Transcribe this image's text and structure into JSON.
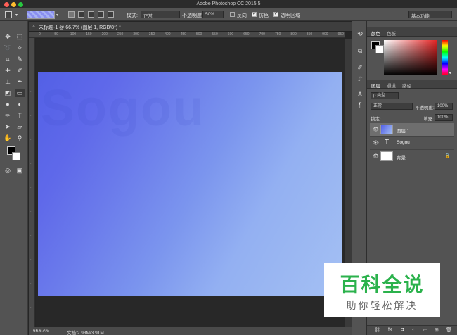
{
  "window": {
    "title": "Adobe Photoshop CC 2015.5"
  },
  "options_bar": {
    "mode_label": "模式:",
    "mode_value": "正常",
    "opacity_label": "不透明度:",
    "opacity_value": "50%",
    "reverse_label": "反向",
    "dither_label": "仿色",
    "transparency_label": "透明区域",
    "reverse_checked": false,
    "dither_checked": true,
    "transparency_checked": true,
    "workspace": "基本功能"
  },
  "document": {
    "tab_title": "未标题-1 @ 66.7% (图层 1, RGB/8*) *",
    "ruler_ticks": [
      "0",
      "50",
      "100",
      "150",
      "200",
      "250",
      "300",
      "350",
      "400",
      "450",
      "500",
      "550",
      "600",
      "650",
      "700",
      "750",
      "800",
      "850",
      "900",
      "950"
    ],
    "canvas_text": "Sogou"
  },
  "status": {
    "zoom": "66.67%",
    "doc_size": "文档:2.93M/3.91M"
  },
  "color_panel": {
    "tabs": [
      "颜色",
      "色板"
    ]
  },
  "layers_panel": {
    "tabs": [
      "图层",
      "通道",
      "路径"
    ],
    "filter_label": "ρ 类型",
    "blend_mode": "正常",
    "opacity_label": "不透明度:",
    "opacity_value": "100%",
    "lock_label": "锁定:",
    "fill_label": "填充:",
    "fill_value": "100%",
    "layers": [
      {
        "name": "图层 1",
        "type": "gradient",
        "selected": true
      },
      {
        "name": "Sogou",
        "type": "text",
        "selected": false
      },
      {
        "name": "背景",
        "type": "background",
        "selected": false
      }
    ]
  },
  "watermark": {
    "main": "百科全说",
    "sub": "助你轻松解决"
  }
}
